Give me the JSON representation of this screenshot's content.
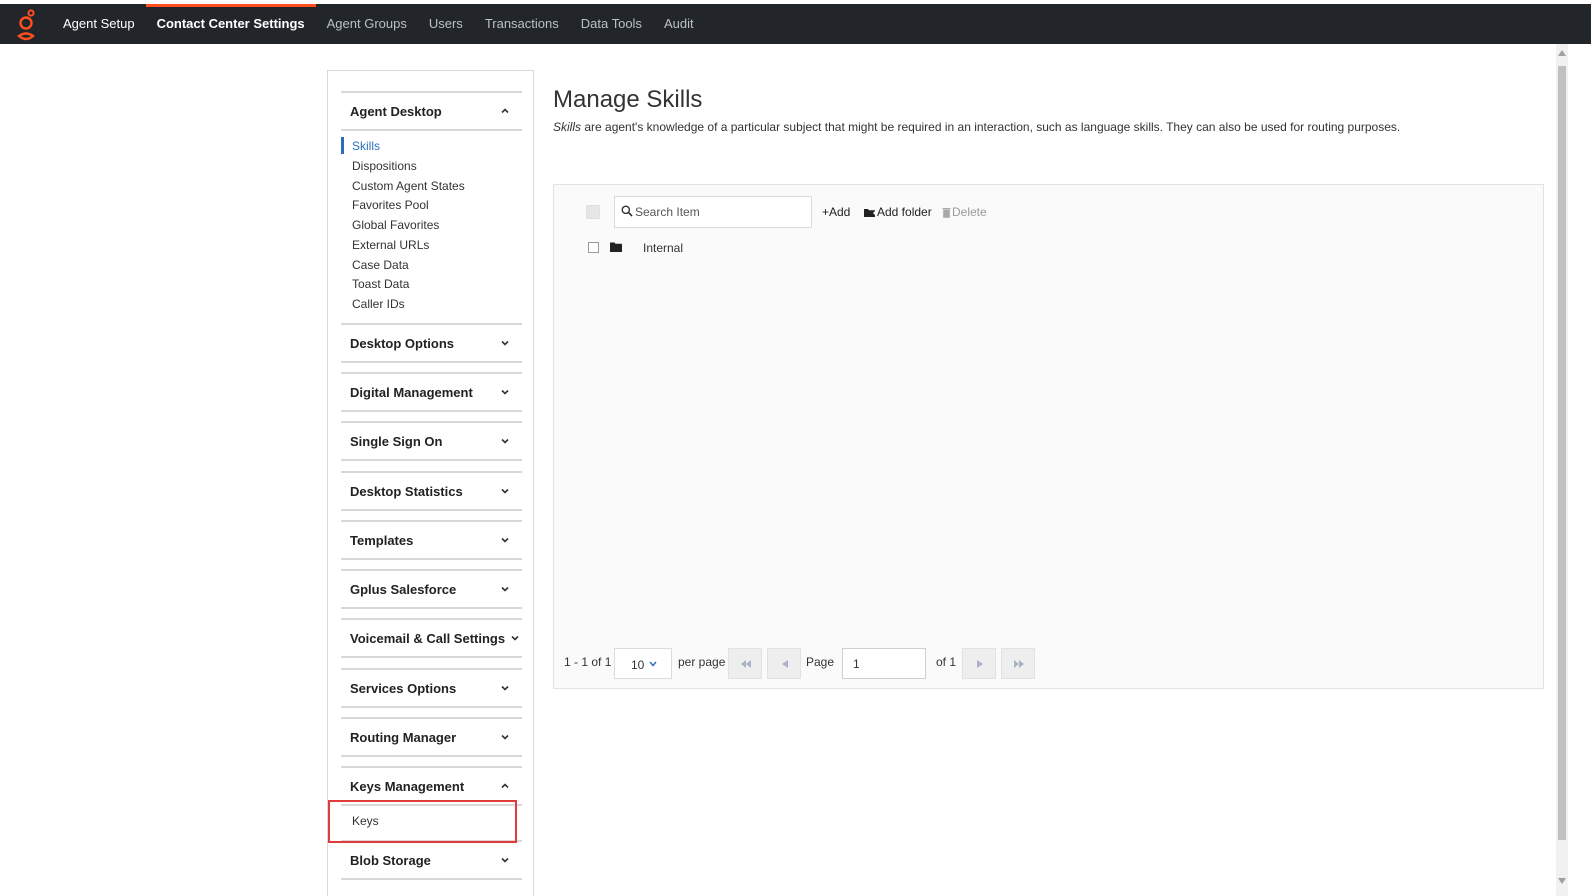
{
  "nav": {
    "logo_icon": "genesys-logo-icon",
    "brand_color": "#ff4f1f",
    "items": [
      {
        "label": "Agent Setup"
      },
      {
        "label": "Contact Center Settings"
      },
      {
        "label": "Agent Groups"
      },
      {
        "label": "Users"
      },
      {
        "label": "Transactions"
      },
      {
        "label": "Data Tools"
      },
      {
        "label": "Audit"
      }
    ],
    "active_index": 1
  },
  "sidebar": {
    "sections": [
      {
        "title": "Agent Desktop",
        "expanded": true,
        "items": [
          {
            "label": "Skills"
          },
          {
            "label": "Dispositions"
          },
          {
            "label": "Custom Agent States"
          },
          {
            "label": "Favorites Pool"
          },
          {
            "label": "Global Favorites"
          },
          {
            "label": "External URLs"
          },
          {
            "label": "Case Data"
          },
          {
            "label": "Toast Data"
          },
          {
            "label": "Caller IDs"
          }
        ]
      },
      {
        "title": "Desktop Options",
        "expanded": false
      },
      {
        "title": "Digital Management",
        "expanded": false
      },
      {
        "title": "Single Sign On",
        "expanded": false
      },
      {
        "title": "Desktop Statistics",
        "expanded": false
      },
      {
        "title": "Templates",
        "expanded": false
      },
      {
        "title": "Gplus Salesforce",
        "expanded": false
      },
      {
        "title": "Voicemail & Call Settings",
        "expanded": false
      },
      {
        "title": "Services Options",
        "expanded": false
      },
      {
        "title": "Routing Manager",
        "expanded": false
      },
      {
        "title": "Keys Management",
        "expanded": true,
        "items": [
          {
            "label": "Keys"
          }
        ]
      },
      {
        "title": "Blob Storage",
        "expanded": false
      }
    ],
    "active_item": "Skills",
    "active_color": "#2a6ebb",
    "highlight_color": "#e23b3b"
  },
  "main": {
    "title": "Manage Skills",
    "description_em": "Skills",
    "description_rest": " are agent's knowledge of a particular subject that might be required in an interaction, such as language skills. They can also be used for routing purposes.",
    "toolbar": {
      "search_placeholder": "Search Item",
      "add_label": "+Add",
      "add_folder_label": "Add folder",
      "delete_label": "Delete"
    },
    "rows": [
      {
        "label": "Internal",
        "icon": "folder-icon"
      }
    ],
    "pager": {
      "range": "1 - 1 of 1",
      "per_page_value": "10",
      "per_page_label": "per page",
      "page_label": "Page",
      "page_value": "1",
      "of_total": "of 1"
    }
  }
}
